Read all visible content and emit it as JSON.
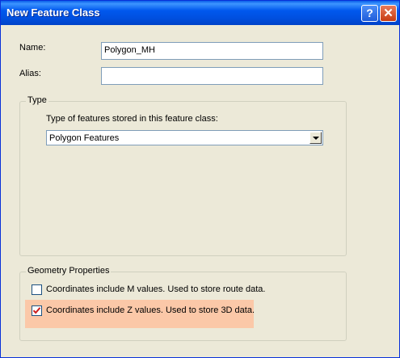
{
  "window": {
    "title": "New Feature Class",
    "help_glyph": "?",
    "close_glyph": "✕",
    "help_icon": "question-mark",
    "close_icon": "close-x"
  },
  "fields": {
    "name_label": "Name:",
    "name_value": "Polygon_MH",
    "alias_label": "Alias:",
    "alias_value": ""
  },
  "type_group": {
    "title": "Type",
    "description": "Type of features stored in this feature class:",
    "selected": "Polygon Features"
  },
  "geometry_group": {
    "title": "Geometry Properties",
    "m_values": {
      "label": "Coordinates include M values. Used to store route data.",
      "checked": false
    },
    "z_values": {
      "label": "Coordinates include Z values. Used to store 3D data.",
      "checked": true
    }
  },
  "colors": {
    "titlebar": "#0058EE",
    "dialog_bg": "#ECE9D8",
    "highlight": "#FBC8A8",
    "check_mark": "#CC1F1F"
  }
}
